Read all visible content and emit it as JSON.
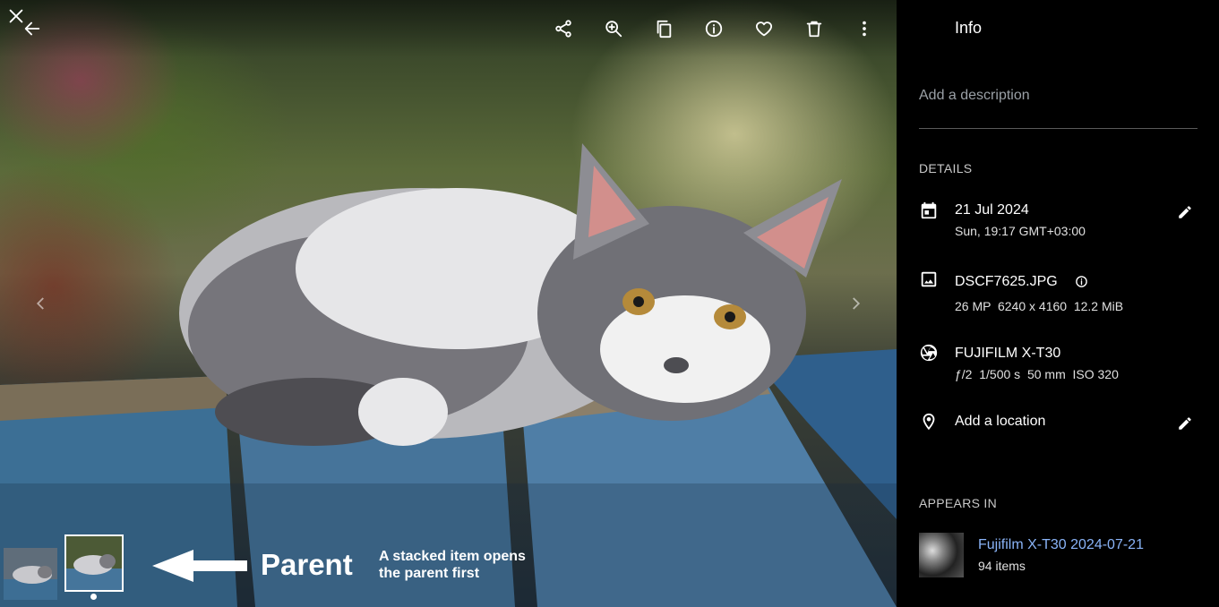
{
  "toolbar": {
    "back_icon": "arrow-left-icon",
    "actions": [
      "share-icon",
      "zoom-in-icon",
      "copy-icon",
      "info-icon",
      "heart-icon",
      "trash-icon",
      "more-vertical-icon"
    ]
  },
  "annotation": {
    "parent_label": "Parent",
    "note_line1": "A stacked item opens",
    "note_line2": "the parent first"
  },
  "info_panel": {
    "title": "Info",
    "description_placeholder": "Add a description",
    "details_heading": "DETAILS",
    "date": {
      "main": "21 Jul 2024",
      "sub": "Sun, 19:17 GMT+03:00"
    },
    "file": {
      "name": "DSCF7625.JPG",
      "sub": "26 MP  6240 x 4160  12.2 MiB"
    },
    "camera": {
      "model": "FUJIFILM X-T30",
      "sub": "ƒ/2  1/500 s  50 mm  ISO 320"
    },
    "location": {
      "main": "Add a location"
    },
    "appears_in_heading": "APPEARS IN",
    "album": {
      "title": "Fujifilm X-T30 2024-07-21",
      "count": "94 items"
    }
  },
  "colors": {
    "panel_bg": "#000000",
    "link": "#8ab4f8",
    "divider": "#5a5a5a"
  }
}
